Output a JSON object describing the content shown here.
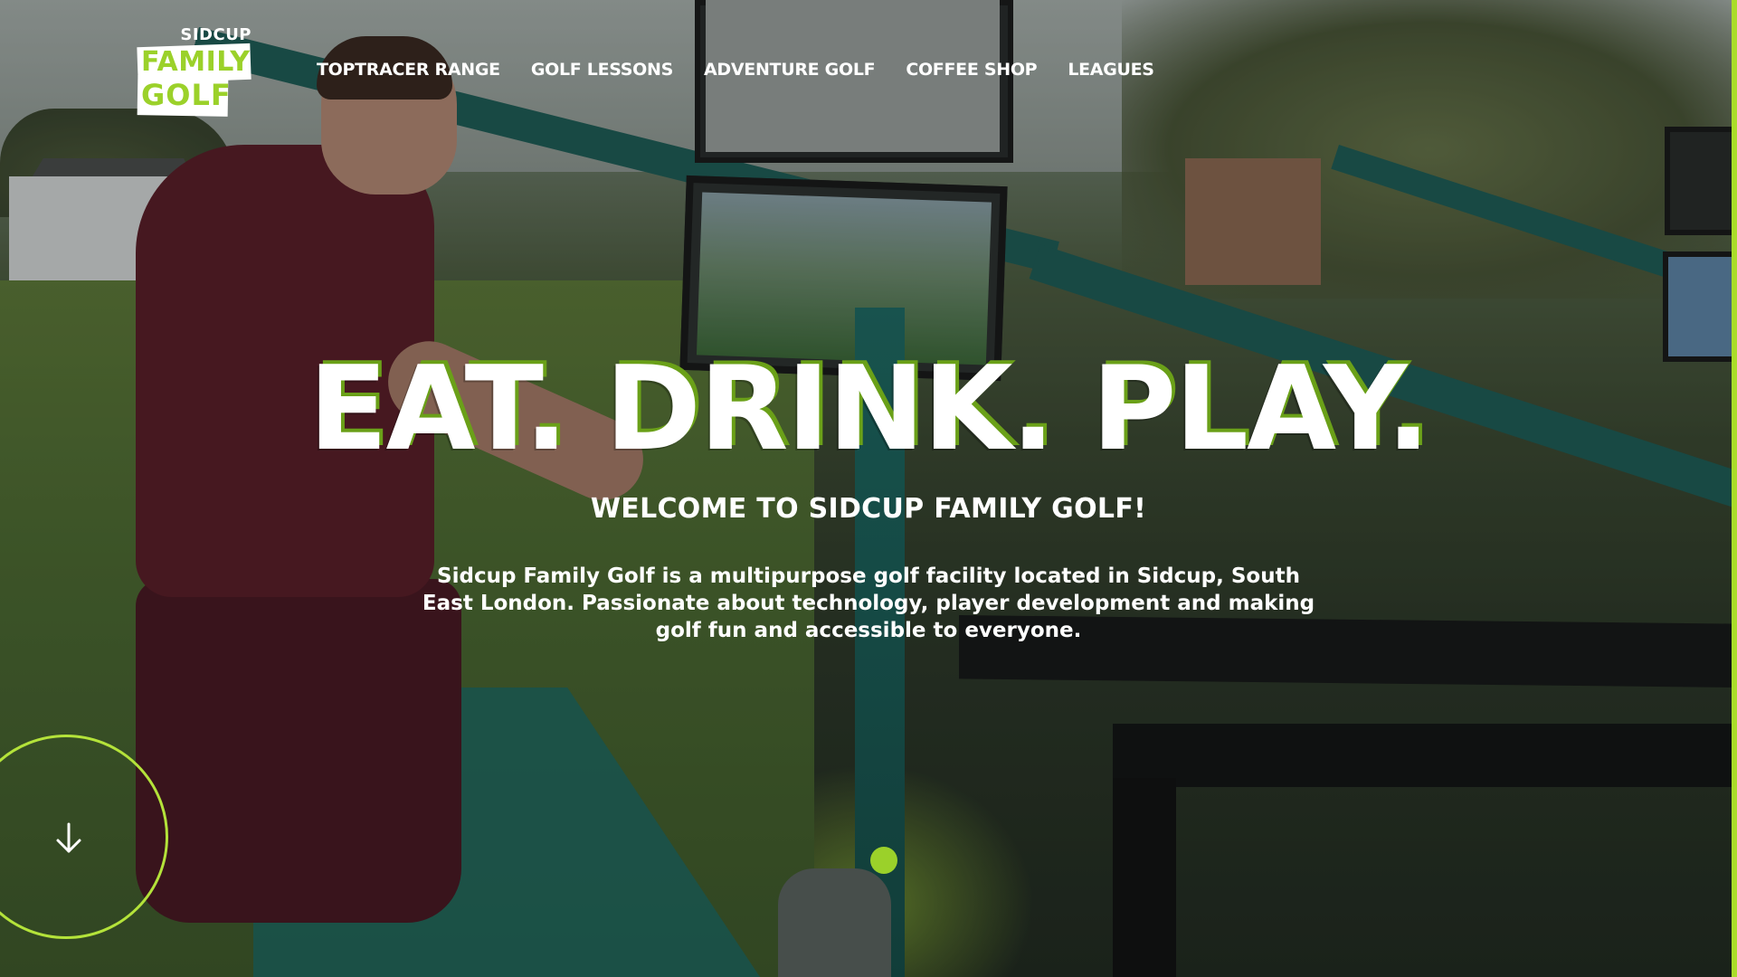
{
  "logo": {
    "top_text": "SIDCUP",
    "line1": "FAMILY",
    "line2": "GOLF"
  },
  "nav": {
    "items": [
      {
        "label": "TOPTRACER RANGE"
      },
      {
        "label": "GOLF LESSONS"
      },
      {
        "label": "ADVENTURE GOLF"
      },
      {
        "label": "COFFEE SHOP"
      },
      {
        "label": "LEAGUES"
      }
    ]
  },
  "hero": {
    "headline": "EAT. DRINK. PLAY.",
    "welcome": "WELCOME TO SIDCUP FAMILY GOLF!",
    "intro": "Sidcup Family Golf is a multipurpose golf facility located in Sidcup, South East London. Passionate about technology, player development and making golf fun and accessible to everyone."
  },
  "controls": {
    "scroll_icon": "arrow-down-icon",
    "slider_dots": 1,
    "active_dot": 1
  },
  "colors": {
    "accent": "#9bd12a",
    "text": "#ffffff",
    "headline_shadow": "#6aa018"
  }
}
